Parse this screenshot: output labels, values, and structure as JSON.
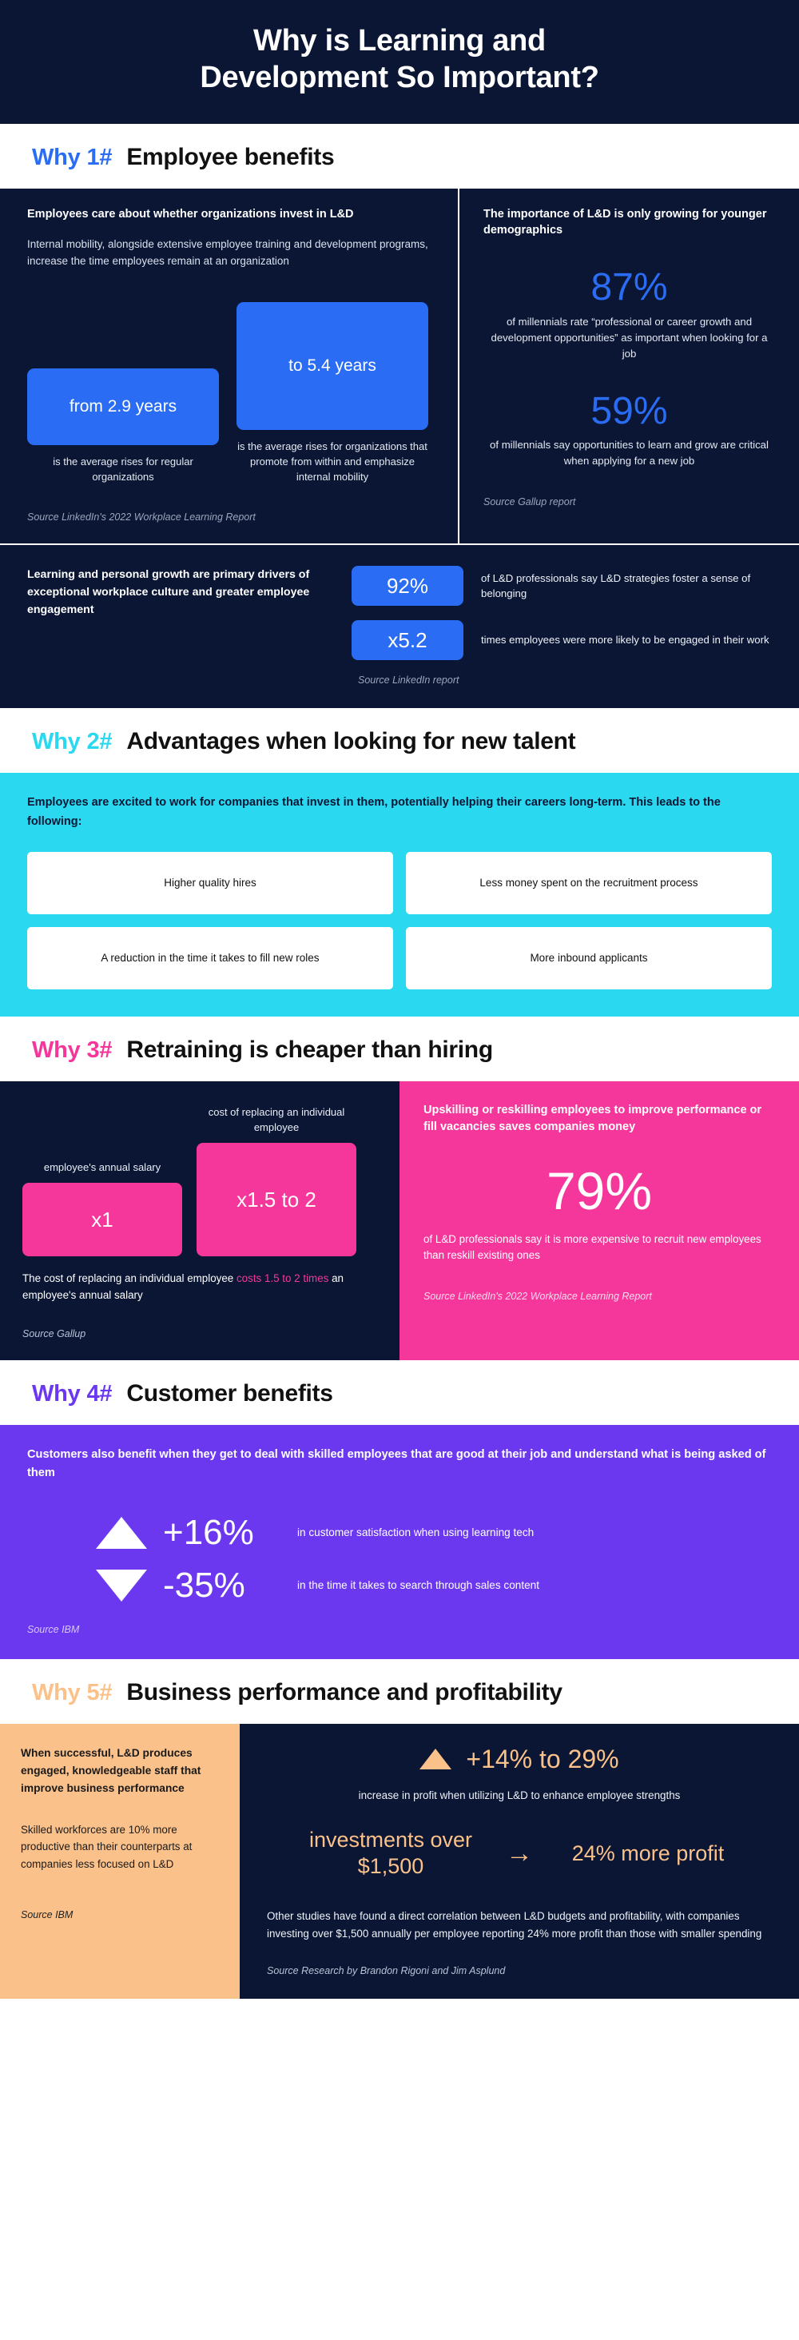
{
  "hero": {
    "title_line1": "Why is Learning and",
    "title_line2": "Development So Important?",
    "bg": "#0a1633"
  },
  "sections": [
    {
      "num": "Why 1#",
      "title": "Employee benefits",
      "accent": "#2a6df4",
      "left": {
        "lead": "Employees care about whether organizations invest in L&D",
        "body": "Internal mobility, alongside extensive employee training and development programs, increase the time employees remain at an organization",
        "bars": [
          {
            "value": "from 2.9 years",
            "caption": "is the average rises for regular organizations"
          },
          {
            "value": "to 5.4 years",
            "caption": "is the average rises for organizations that promote from within and emphasize internal mobility"
          }
        ],
        "source": "Source LinkedIn's 2022 Workplace Learning Report"
      },
      "right": {
        "lead": "The importance of L&D is only growing for younger demographics",
        "stats": [
          {
            "pct": "87%",
            "caption": "of millennials rate “professional or career growth and development opportunities” as important when looking for a job"
          },
          {
            "pct": "59%",
            "caption": "of millennials say opportunities to learn and grow are critical when applying for a new job"
          }
        ],
        "source": "Source Gallup report"
      },
      "strip": {
        "lead": "Learning and personal growth are primary drivers of exceptional workplace culture and greater employee engagement",
        "stats": [
          {
            "chip": "92%",
            "text": "of L&D professionals say L&D strategies foster a sense of belonging"
          },
          {
            "chip": "x5.2",
            "text": "times employees were more likely to be engaged in their work"
          }
        ],
        "source": "Source LinkedIn report"
      }
    },
    {
      "num": "Why 2#",
      "title": "Advantages when looking for new talent",
      "accent": "#2ad8f0",
      "lead": "Employees are excited to work for companies that invest in them, potentially helping their careers long-term. This leads to the following:",
      "cards": [
        "Higher quality hires",
        "Less money spent on the recruitment process",
        "A reduction in the time it takes to fill new roles",
        "More inbound applicants"
      ]
    },
    {
      "num": "Why 3#",
      "title": "Retraining is cheaper than hiring",
      "accent": "#f5379b",
      "left": {
        "bars": [
          {
            "caption": "employee's annual salary",
            "value": "x1"
          },
          {
            "caption": "cost of replacing an individual employee",
            "value": "x1.5 to 2"
          }
        ],
        "note_a": "The cost of replacing an individual employee ",
        "note_hi": "costs 1.5 to 2 times",
        "note_b": " an employee's annual salary",
        "source": "Source Gallup"
      },
      "right": {
        "lead": "Upskilling or reskilling employees to improve performance or fill vacancies saves companies money",
        "big": "79%",
        "caption": "of L&D professionals say it is more expensive to recruit new employees than reskill existing ones",
        "source": "Source LinkedIn's 2022 Workplace Learning Report"
      }
    },
    {
      "num": "Why 4#",
      "title": "Customer benefits",
      "accent": "#6b38f0",
      "lead": "Customers also benefit when they get to deal with skilled employees that are good at their job and understand what is being asked of them",
      "rows": [
        {
          "direction": "up",
          "value": "+16%",
          "caption": "in customer satisfaction when using learning tech"
        },
        {
          "direction": "down",
          "value": "-35%",
          "caption": "in the time it takes to search through sales content"
        }
      ],
      "source": "Source IBM"
    },
    {
      "num": "Why 5#",
      "title": "Business performance and profitability",
      "accent": "#fbc18a",
      "left": {
        "lead": "When successful, L&D produces engaged, knowledgeable staff that improve business performance",
        "body": "Skilled workforces are 10% more productive than their counterparts at companies less focused on L&D",
        "source": "Source IBM"
      },
      "right": {
        "top_value": "+14% to 29%",
        "top_caption": "increase in profit when utilizing L&D to enhance employee strengths",
        "arrow_left": "investments over $1,500",
        "arrow_glyph": "→",
        "arrow_right": "24% more profit",
        "note": "Other studies have found a direct correlation between L&D budgets and profitability, with companies investing over $1,500 annually per employee reporting 24% more profit than those with smaller spending",
        "source": "Source Research by Brandon Rigoni and Jim Asplund"
      }
    }
  ]
}
